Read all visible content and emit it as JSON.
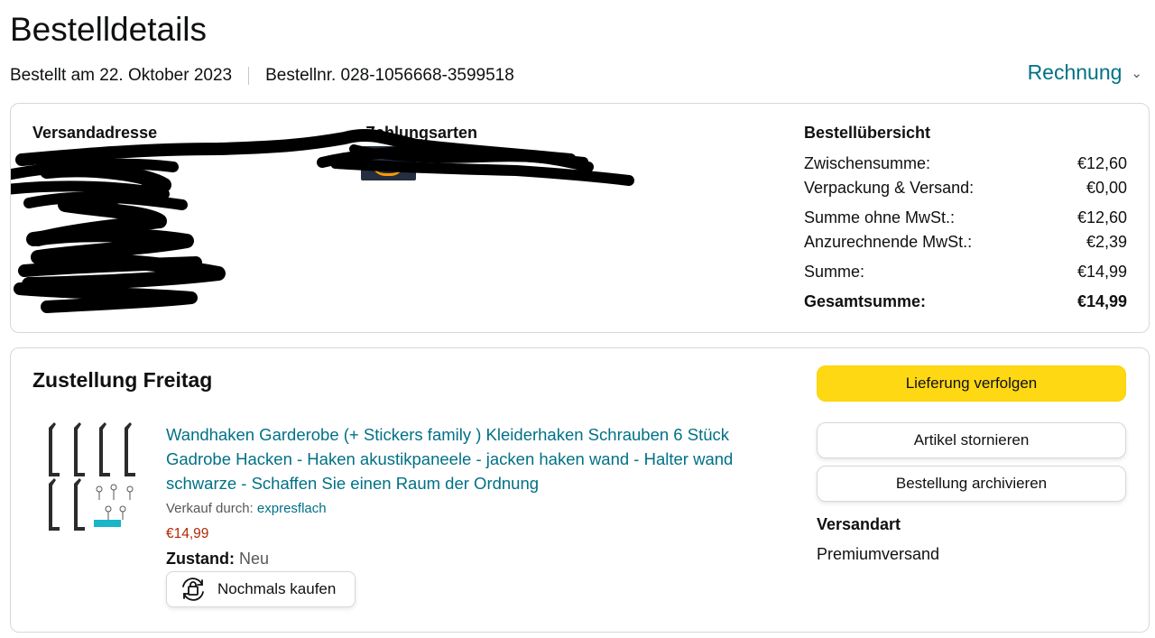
{
  "header": {
    "title": "Bestelldetails",
    "ordered": "Bestellt am 22. Oktober 2023",
    "order_number": "Bestellnr. 028-1056668-3599518",
    "invoice_label": "Rechnung",
    "invoice_icon": "chevron-down-icon"
  },
  "info": {
    "shipping_address_heading": "Versandadresse",
    "payment_heading": "Zahlungsarten",
    "payment_icon": "amazon-logo",
    "redacted": true
  },
  "summary": {
    "heading": "Bestellübersicht",
    "rows": [
      {
        "label": "Zwischensumme:",
        "value": "€12,60"
      },
      {
        "label": "Verpackung & Versand:",
        "value": "€0,00"
      },
      {
        "label": "Summe ohne MwSt.:",
        "value": "€12,60"
      },
      {
        "label": "Anzurechnende MwSt.:",
        "value": "€2,39"
      },
      {
        "label": "Summe:",
        "value": "€14,99"
      }
    ],
    "total": {
      "label": "Gesamtsumme:",
      "value": "€14,99"
    }
  },
  "delivery": {
    "heading": "Zustellung Freitag",
    "product": {
      "title": "Wandhaken Garderobe (+ Stickers family ) Kleiderhaken Schrauben 6 Stück Gadrobe Hacken - Haken akustikpaneele - jacken haken wand - Halter wand schwarze - Schaffen Sie einen Raum der Ordnung",
      "seller_label": "Verkauf durch: ",
      "seller_name": "expresflach",
      "price": "€14,99",
      "condition_label": "Zustand:",
      "condition_value": "Neu",
      "buy_again": "Nochmals kaufen"
    },
    "actions": {
      "track": "Lieferung verfolgen",
      "cancel": "Artikel stornieren",
      "archive": "Bestellung archivieren"
    },
    "shipping_method_heading": "Versandart",
    "shipping_method": "Premiumversand"
  },
  "colors": {
    "link": "#007185",
    "price": "#b12704",
    "primary_button": "#ffd814",
    "border": "#d5d9d9"
  }
}
